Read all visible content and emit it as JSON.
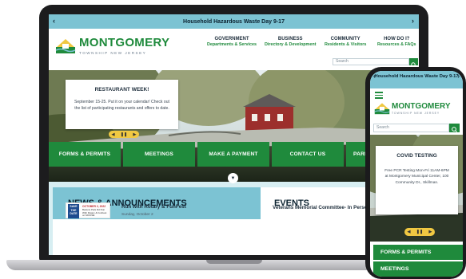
{
  "laptop": {
    "alert": {
      "text": "Household Hazardous Waste Day 9-17"
    },
    "header": {
      "logo_name": "MONTGOMERY",
      "logo_sub": "TOWNSHIP NEW JERSEY",
      "nav": [
        {
          "title": "GOVERNMENT",
          "sub": "Departments & Services"
        },
        {
          "title": "BUSINESS",
          "sub": "Directory & Development"
        },
        {
          "title": "COMMUNITY",
          "sub": "Residents & Visitors"
        },
        {
          "title": "HOW DO I?",
          "sub": "Resources & FAQs"
        }
      ],
      "search_placeholder": "Search"
    },
    "hero_card": {
      "title": "RESTAURANT WEEK!",
      "body": "September 15-25. Put it on your calendar! Check out the list of participating restaurants and offers to date."
    },
    "quick_links": [
      "FORMS & PERMITS",
      "MEETINGS",
      "MAKE A PAYMENT",
      "CONTACT US",
      "PARKS"
    ],
    "news": {
      "heading": "NEWS & ANNOUNCEMENTS",
      "item_title": "Run with Rotary & FunFest",
      "item_date": "Sunday, October 2",
      "thumb_date": "SAVE THE DATE",
      "thumb_month": "OCTOBER 2, 2022",
      "thumb_text": "Bedens Park Rd Run With Rotary & FunFest on MOOSE"
    },
    "events": {
      "heading": "EVENTS",
      "item_title": "Veterans Memorial Committee- In Person"
    }
  },
  "phone": {
    "alert": {
      "text": "Household Hazardous Waste Day 9-17"
    },
    "logo_name": "MONTGOMERY",
    "logo_sub": "TOWNSHIP NEW JERSEY",
    "search_placeholder": "Search",
    "card": {
      "title": "COVID TESTING",
      "body": "Free PCR Testing Mon-Fri 11AM-6PM at Montgomery Municipal Center, 100 Community Dr., Skillman."
    },
    "quick_links": [
      "FORMS & PERMITS",
      "MEETINGS"
    ]
  },
  "colors": {
    "brand_green": "#1f8a3c",
    "alert_blue": "#7cc3d3",
    "accent_yellow": "#f0c842"
  },
  "icons": [
    "chevron-left-icon",
    "chevron-right-icon",
    "search-icon",
    "pause-icon",
    "chevron-down-icon",
    "hamburger-menu-icon",
    "township-logo-icon"
  ]
}
